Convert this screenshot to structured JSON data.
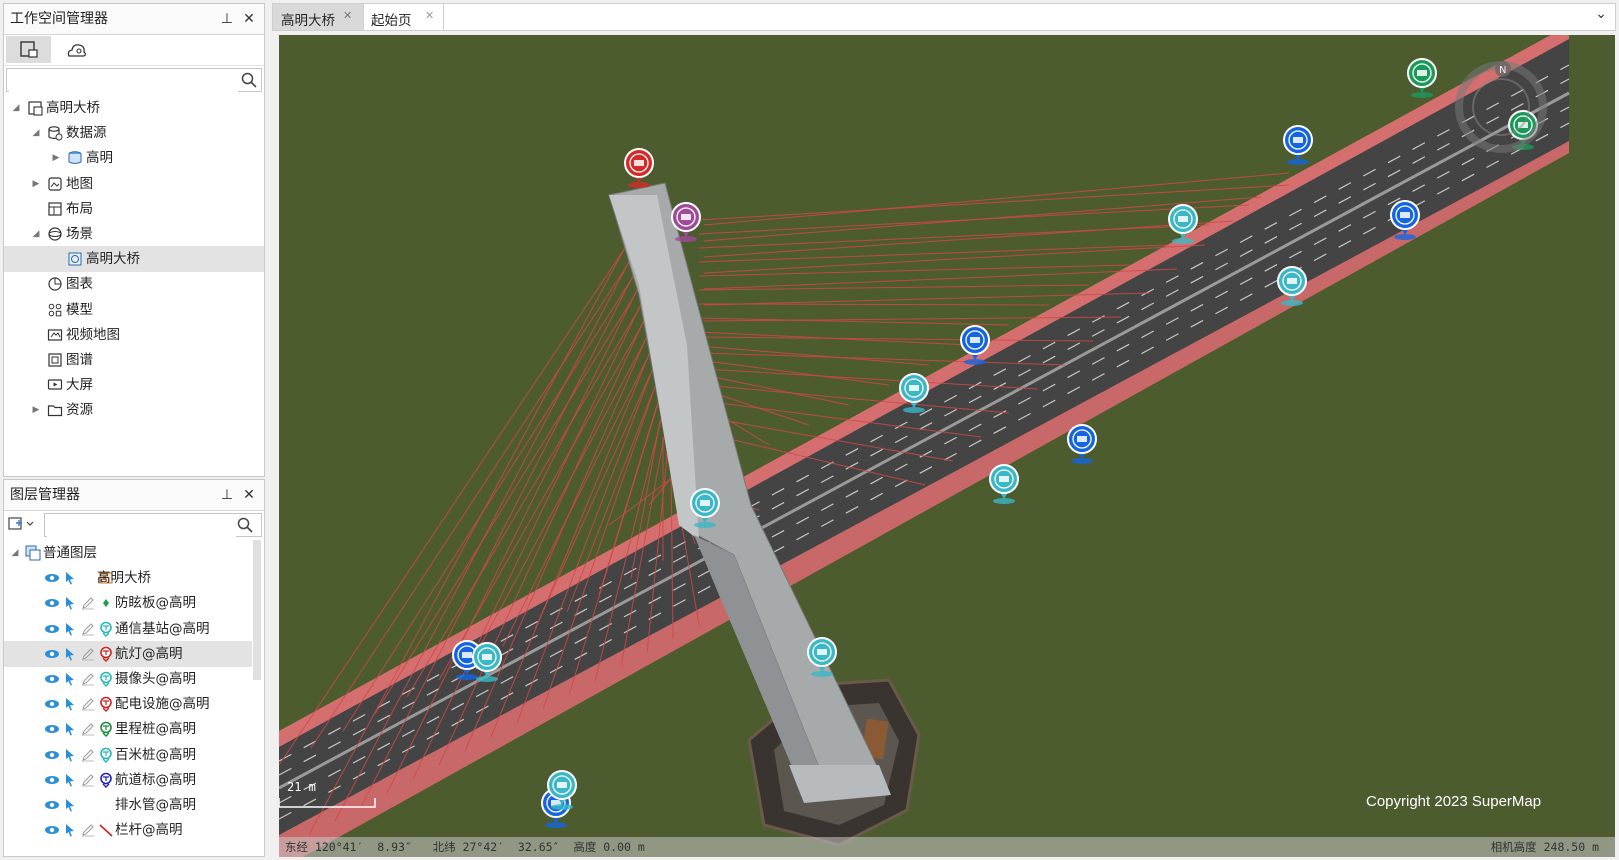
{
  "workspace": {
    "title": "工作空间管理器",
    "search_placeholder": "",
    "tree": [
      {
        "label": "高明大桥",
        "level": 0,
        "expand": "▲",
        "icon": "workspace-icon"
      },
      {
        "label": "数据源",
        "level": 1,
        "expand": "▲",
        "icon": "datasource-icon"
      },
      {
        "label": "高明",
        "level": 2,
        "expand": "▶",
        "icon": "database-icon"
      },
      {
        "label": "地图",
        "level": 1,
        "expand": "▶",
        "icon": "map-icon"
      },
      {
        "label": "布局",
        "level": 1,
        "expand": "",
        "icon": "layout-icon"
      },
      {
        "label": "场景",
        "level": 1,
        "expand": "▲",
        "icon": "scene-icon"
      },
      {
        "label": "高明大桥",
        "level": 2,
        "expand": "",
        "icon": "scene-item-icon",
        "selected": true
      },
      {
        "label": "图表",
        "level": 1,
        "expand": "",
        "icon": "chart-icon"
      },
      {
        "label": "模型",
        "level": 1,
        "expand": "",
        "icon": "model-icon"
      },
      {
        "label": "视频地图",
        "level": 1,
        "expand": "",
        "icon": "video-map-icon"
      },
      {
        "label": "图谱",
        "level": 1,
        "expand": "",
        "icon": "graph-icon"
      },
      {
        "label": "大屏",
        "level": 1,
        "expand": "",
        "icon": "screen-icon"
      },
      {
        "label": "资源",
        "level": 1,
        "expand": "▶",
        "icon": "resource-folder-icon"
      }
    ]
  },
  "layers": {
    "title": "图层管理器",
    "search_placeholder": "",
    "group": "普通图层",
    "items": [
      {
        "label": "高明大桥",
        "color": "#c87a2a",
        "edit": false
      },
      {
        "label": "防眩板@高明",
        "color": "#1aa04a",
        "edit": true
      },
      {
        "label": "通信基站@高明",
        "color": "#22b8b8",
        "edit": true
      },
      {
        "label": "航灯@高明",
        "color": "#cc2222",
        "edit": true,
        "selected": true
      },
      {
        "label": "摄像头@高明",
        "color": "#22b8b8",
        "edit": true
      },
      {
        "label": "配电设施@高明",
        "color": "#cc2222",
        "edit": true
      },
      {
        "label": "里程桩@高明",
        "color": "#1a8a3a",
        "edit": true
      },
      {
        "label": "百米桩@高明",
        "color": "#22b8b8",
        "edit": true
      },
      {
        "label": "航道标@高明",
        "color": "#2222bb",
        "edit": true
      },
      {
        "label": "排水管@高明",
        "color": "#ffffff",
        "edit": false
      },
      {
        "label": "栏杆@高明",
        "color": "#d02020",
        "edit": true
      }
    ]
  },
  "tabs": [
    {
      "label": "高明大桥",
      "active": true
    },
    {
      "label": "起始页",
      "active": false
    }
  ],
  "tabs_dropdown": "⌄",
  "scene": {
    "scale_label": "21 m",
    "compass_label": "N",
    "copyright": "Copyright 2023 SuperMap",
    "status_left": "东经 120°41′  8.93″   北纬 27°42′  32.65″  高度 0.00 m",
    "status_right": "相机高度 248.50 m"
  },
  "colors": {
    "ground": "#4d5c2f",
    "deck": "#444444",
    "rail": "#d56f6f",
    "cable": "#d04848",
    "tower": "#a4a8aa"
  }
}
